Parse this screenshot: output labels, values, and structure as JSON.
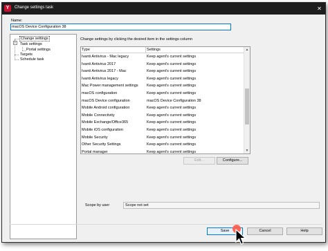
{
  "window": {
    "title": "Change settings task",
    "logo_letter": "Y",
    "close_glyph": "✕"
  },
  "name_field": {
    "label": "Name:",
    "value": "macOS Device Configuration 38"
  },
  "nav_tree": {
    "expander": "−",
    "items": [
      {
        "label": "Change settings",
        "selected": true
      },
      {
        "label": "Task settings"
      },
      {
        "label": "Portal settings"
      },
      {
        "label": "Targets"
      },
      {
        "label": "Schedule task"
      }
    ]
  },
  "main": {
    "description": "Change settings by clicking the desired item in the settings column",
    "columns": [
      "Type",
      "Settings"
    ],
    "rows": [
      {
        "type": "Ivanti Antivirus - Mac legacy",
        "setting": "Keep agent's current settings"
      },
      {
        "type": "Ivanti Antivirus 2017",
        "setting": "Keep agent's current settings"
      },
      {
        "type": "Ivanti Antivirus 2017 - Mac",
        "setting": "Keep agent's current settings"
      },
      {
        "type": "Ivanti Antivirus legacy",
        "setting": "Keep agent's current settings"
      },
      {
        "type": "Mac Power management settings",
        "setting": "Keep agent's current settings"
      },
      {
        "type": "macOS configuration",
        "setting": "Keep agent's current settings"
      },
      {
        "type": "macOS Device configuration",
        "setting": "macOS Device Configuration 38"
      },
      {
        "type": "Mobile Android configuration",
        "setting": "Keep agent's current settings"
      },
      {
        "type": "Mobile Connectivity",
        "setting": "Keep agent's current settings"
      },
      {
        "type": "Mobile Exchange/Office365",
        "setting": "Keep agent's current settings"
      },
      {
        "type": "Mobile iOS configuration",
        "setting": "Keep agent's current settings"
      },
      {
        "type": "Mobile Security",
        "setting": "Keep agent's current settings"
      },
      {
        "type": "Other Security Settings",
        "setting": "Keep agent's current settings"
      },
      {
        "type": "Portal manager",
        "setting": "Keep agent's current settings"
      }
    ],
    "scroll_up": "▲",
    "scroll_down": "▼",
    "edit_button": "Edit...",
    "configure_button": "Configure...",
    "scope_label": "Scope by user",
    "scope_value": "Scope not set"
  },
  "footer": {
    "save_label": "Save",
    "cancel_label": "Cancel",
    "help_label": "Help"
  },
  "colors": {
    "titlebar": "#1e1e1e",
    "logo": "#c8102e",
    "focus_border": "#0078d7",
    "click_indicator": "#ff5a46"
  }
}
